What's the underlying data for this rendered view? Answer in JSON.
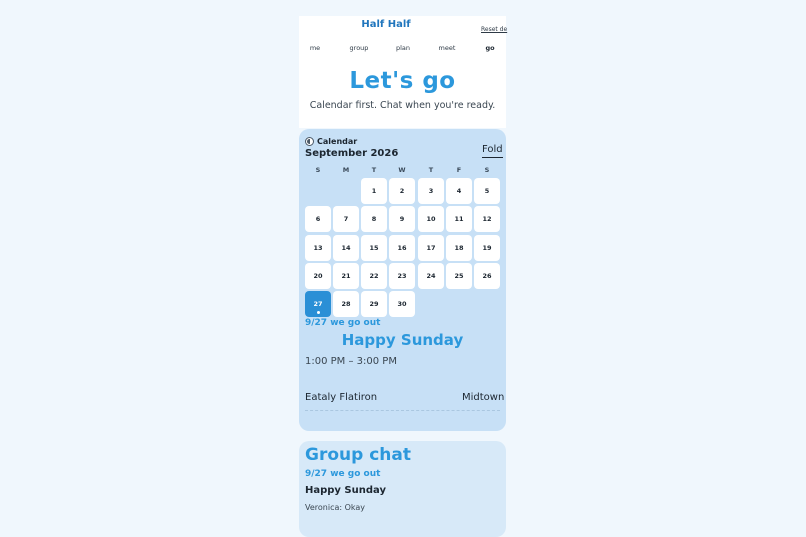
{
  "app": {
    "brand": "Half Half",
    "reset_label": "Reset de"
  },
  "nav": {
    "items": [
      {
        "label": "me",
        "active": false
      },
      {
        "label": "group",
        "active": false
      },
      {
        "label": "plan",
        "active": false
      },
      {
        "label": "meet",
        "active": false
      },
      {
        "label": "go",
        "active": true
      }
    ]
  },
  "hero": {
    "title": "Let's go",
    "subtitle": "Calendar first. Chat when you're ready."
  },
  "calendar": {
    "icon": "clock-icon",
    "label": "Calendar",
    "month": "September 2026",
    "fold_label": "Fold",
    "weekdays": [
      "S",
      "M",
      "T",
      "W",
      "T",
      "F",
      "S"
    ],
    "first_weekday_index": 2,
    "days": [
      "1",
      "2",
      "3",
      "4",
      "5",
      "6",
      "7",
      "8",
      "9",
      "10",
      "11",
      "12",
      "13",
      "14",
      "15",
      "16",
      "17",
      "18",
      "19",
      "20",
      "21",
      "22",
      "23",
      "24",
      "25",
      "26",
      "27",
      "28",
      "29",
      "30"
    ],
    "selected_day": "27",
    "event_days": [
      "27"
    ]
  },
  "event": {
    "date_label": "9/27 we go out",
    "title": "Happy Sunday",
    "time": "1:00 PM – 3:00 PM",
    "place": "Eataly Flatiron",
    "area": "Midtown"
  },
  "chat": {
    "title": "Group chat",
    "event_date_label": "9/27 we go out",
    "event_name": "Happy Sunday",
    "last_message": "Veronica: Okay"
  },
  "colors": {
    "accent": "#2c98dc",
    "card_bg": "#c7e0f6",
    "chat_bg": "#d7e9f8",
    "page_bg": "#f0f7fd",
    "selected_day": "#2a8fd6"
  }
}
